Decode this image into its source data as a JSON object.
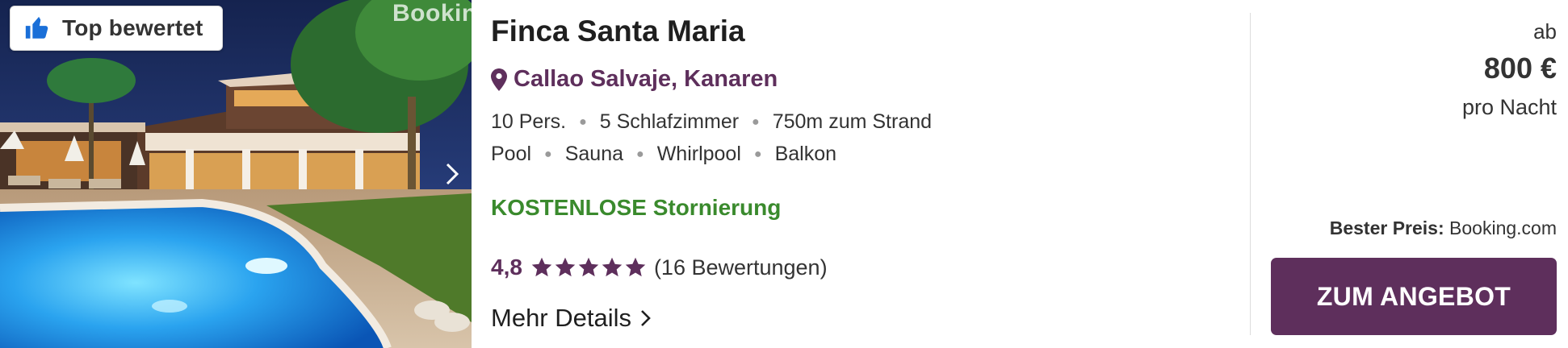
{
  "listing": {
    "badge_label": "Top bewertet",
    "watermark": "Bookin",
    "title": "Finca Santa Maria",
    "location": "Callao Salvaje, Kanaren",
    "facts_row1": [
      "10 Pers.",
      "5 Schlafzimmer",
      "750m zum Strand"
    ],
    "facts_row2": [
      "Pool",
      "Sauna",
      "Whirlpool",
      "Balkon"
    ],
    "cancellation": "KOSTENLOSE Stornierung",
    "rating_score": "4,8",
    "rating_stars": 5,
    "rating_count": "(16 Bewertungen)",
    "more_details": "Mehr Details"
  },
  "pricing": {
    "from_label": "ab",
    "price": "800 €",
    "per_night": "pro Nacht",
    "best_price_label": "Bester Preis:",
    "best_price_source": "Booking.com",
    "cta_label": "ZUM ANGEBOT"
  },
  "icons": {
    "badge": "thumbs-up-icon",
    "location": "map-pin-icon",
    "rating": "star-icon",
    "more": "chevron-right-icon",
    "gallery_next": "chevron-right-icon"
  },
  "colors": {
    "brand_purple": "#5e2f5c",
    "cancellation_green": "#3a8a2d",
    "star": "#5e2f5c",
    "badge_icon_blue": "#1a6fd8"
  }
}
